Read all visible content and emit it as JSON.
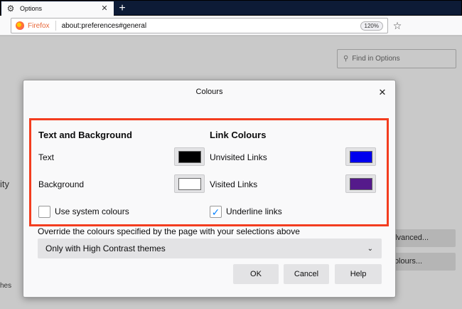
{
  "tab": {
    "title": "Options",
    "close": "✕",
    "new_tab": "+"
  },
  "navbar": {
    "brand": "Firefox",
    "url": "about:preferences#general",
    "zoom": "120%"
  },
  "page": {
    "find_placeholder": "Find in Options",
    "partial_text_1": "ity",
    "partial_text_2": "hes",
    "advanced_button": "Advanced...",
    "colours_button": "Colours..."
  },
  "dialog": {
    "title": "Colours",
    "text_and_background": {
      "heading": "Text and Background",
      "text_label": "Text",
      "text_color": "#000000",
      "background_label": "Background",
      "background_color": "#ffffff",
      "use_system_colours_label": "Use system colours",
      "use_system_colours_checked": false
    },
    "link_colours": {
      "heading": "Link Colours",
      "unvisited_label": "Unvisited Links",
      "unvisited_color": "#0000ee",
      "visited_label": "Visited Links",
      "visited_color": "#551a8b",
      "underline_label": "Underline links",
      "underline_checked": true
    },
    "override_label": "Override the colours specified by the page with your selections above",
    "override_value": "Only with High Contrast themes",
    "buttons": {
      "ok": "OK",
      "cancel": "Cancel",
      "help": "Help"
    }
  },
  "colors": {
    "highlight": "#f33d1f",
    "accent": "#0a84ff"
  }
}
